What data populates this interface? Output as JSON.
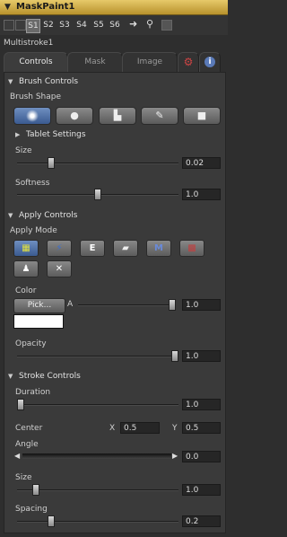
{
  "title": "MaskPaint1",
  "toolbar": {
    "slots": [
      "S1",
      "S2",
      "S3",
      "S4",
      "S5",
      "S6"
    ],
    "active_slot": "S1"
  },
  "tool_name": "Multistroke1",
  "tabs": {
    "controls": "Controls",
    "mask": "Mask",
    "image": "Image"
  },
  "brush_controls": {
    "header": "Brush Controls",
    "shape_label": "Brush Shape",
    "shapes": [
      "soft-brush-icon",
      "circle-brush-icon",
      "image-brush-icon",
      "pencil-brush-icon",
      "square-brush-icon"
    ],
    "tablet_label": "Tablet Settings",
    "size": {
      "label": "Size",
      "value": "0.02",
      "fraction": 0.2
    },
    "softness": {
      "label": "Softness",
      "value": "1.0",
      "fraction": 0.5
    }
  },
  "apply_controls": {
    "header": "Apply Controls",
    "mode_label": "Apply Mode",
    "modes": [
      "color-mode-icon",
      "clone-mode-icon",
      "emboss-mode-icon",
      "erase-mode-icon",
      "merge-mode-icon",
      "smear-mode-icon",
      "stamp-mode-icon",
      "wire-mode-icon"
    ],
    "emboss_glyph": "E",
    "merge_glyph": "M",
    "color": {
      "label": "Color",
      "pick": "Pick...",
      "a_label": "A",
      "value": "1.0",
      "swatch": "#ffffff"
    },
    "opacity": {
      "label": "Opacity",
      "value": "1.0",
      "fraction": 1.0
    }
  },
  "stroke_controls": {
    "header": "Stroke Controls",
    "duration": {
      "label": "Duration",
      "value": "1.0",
      "fraction": 0.0
    },
    "center": {
      "label": "Center",
      "x_label": "X",
      "x": "0.5",
      "y_label": "Y",
      "y": "0.5"
    },
    "angle": {
      "label": "Angle",
      "value": "0.0"
    },
    "size": {
      "label": "Size",
      "value": "1.0",
      "fraction": 0.1
    },
    "spacing": {
      "label": "Spacing",
      "value": "0.2",
      "fraction": 0.2
    }
  }
}
